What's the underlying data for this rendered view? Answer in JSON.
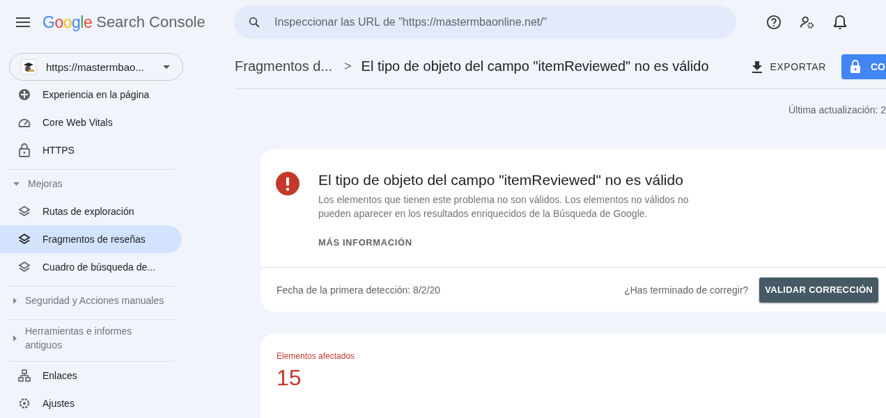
{
  "header": {
    "logo": "Google",
    "product": "Search Console",
    "search": {
      "placeholder": "Inspeccionar las URL de \"https://mastermbaonline.net/\""
    }
  },
  "property": {
    "label": "https://mastermbao..."
  },
  "sidebar": {
    "groups": [
      {
        "items": [
          {
            "kind": "item",
            "label": "Experiencia en la página",
            "selected": false
          },
          {
            "kind": "item",
            "label": "Core Web Vitals",
            "selected": false
          },
          {
            "kind": "item",
            "label": "HTTPS",
            "selected": false
          }
        ]
      },
      {
        "items": [
          {
            "kind": "section",
            "label": "Mejoras",
            "expanded": true,
            "children": [
              {
                "label": "Rutas de exploración",
                "selected": false
              },
              {
                "label": "Fragmentos de reseñas",
                "selected": true
              },
              {
                "label": "Cuadro de búsqueda de...",
                "selected": false
              }
            ]
          }
        ]
      },
      {
        "items": [
          {
            "kind": "section",
            "label": "Seguridad y Acciones manuales",
            "expanded": false
          }
        ]
      },
      {
        "items": [
          {
            "kind": "section",
            "label": "Herramientas e informes antiguos",
            "expanded": false
          }
        ]
      },
      {
        "items": [
          {
            "kind": "item",
            "label": "Enlaces",
            "selected": false
          },
          {
            "kind": "item",
            "label": "Ajustes",
            "selected": false
          }
        ]
      }
    ]
  },
  "breadcrumb": {
    "parent": "Fragmentos d...",
    "separator": ">",
    "current": "El tipo de objeto del campo \"itemReviewed\" no es válido"
  },
  "actions": {
    "export": "EXPORTAR",
    "share": "CO"
  },
  "last_update": "Última actualización: 2",
  "issue": {
    "title": "El tipo de objeto del campo \"itemReviewed\" no es válido",
    "description": "Los elementos que tienen este problema no son válidos. Los elementos no válidos no pueden aparecer en los resultados enriquecidos de la Búsqueda de Google.",
    "link": "MÁS INFORMACIÓN",
    "first_detected": "Fecha de la primera detección: 8/2/20",
    "question": "¿Has terminado de corregir?",
    "validate": "VALIDAR CORRECCIÓN"
  },
  "affected": {
    "label": "Elementos afectados",
    "count": "15"
  }
}
